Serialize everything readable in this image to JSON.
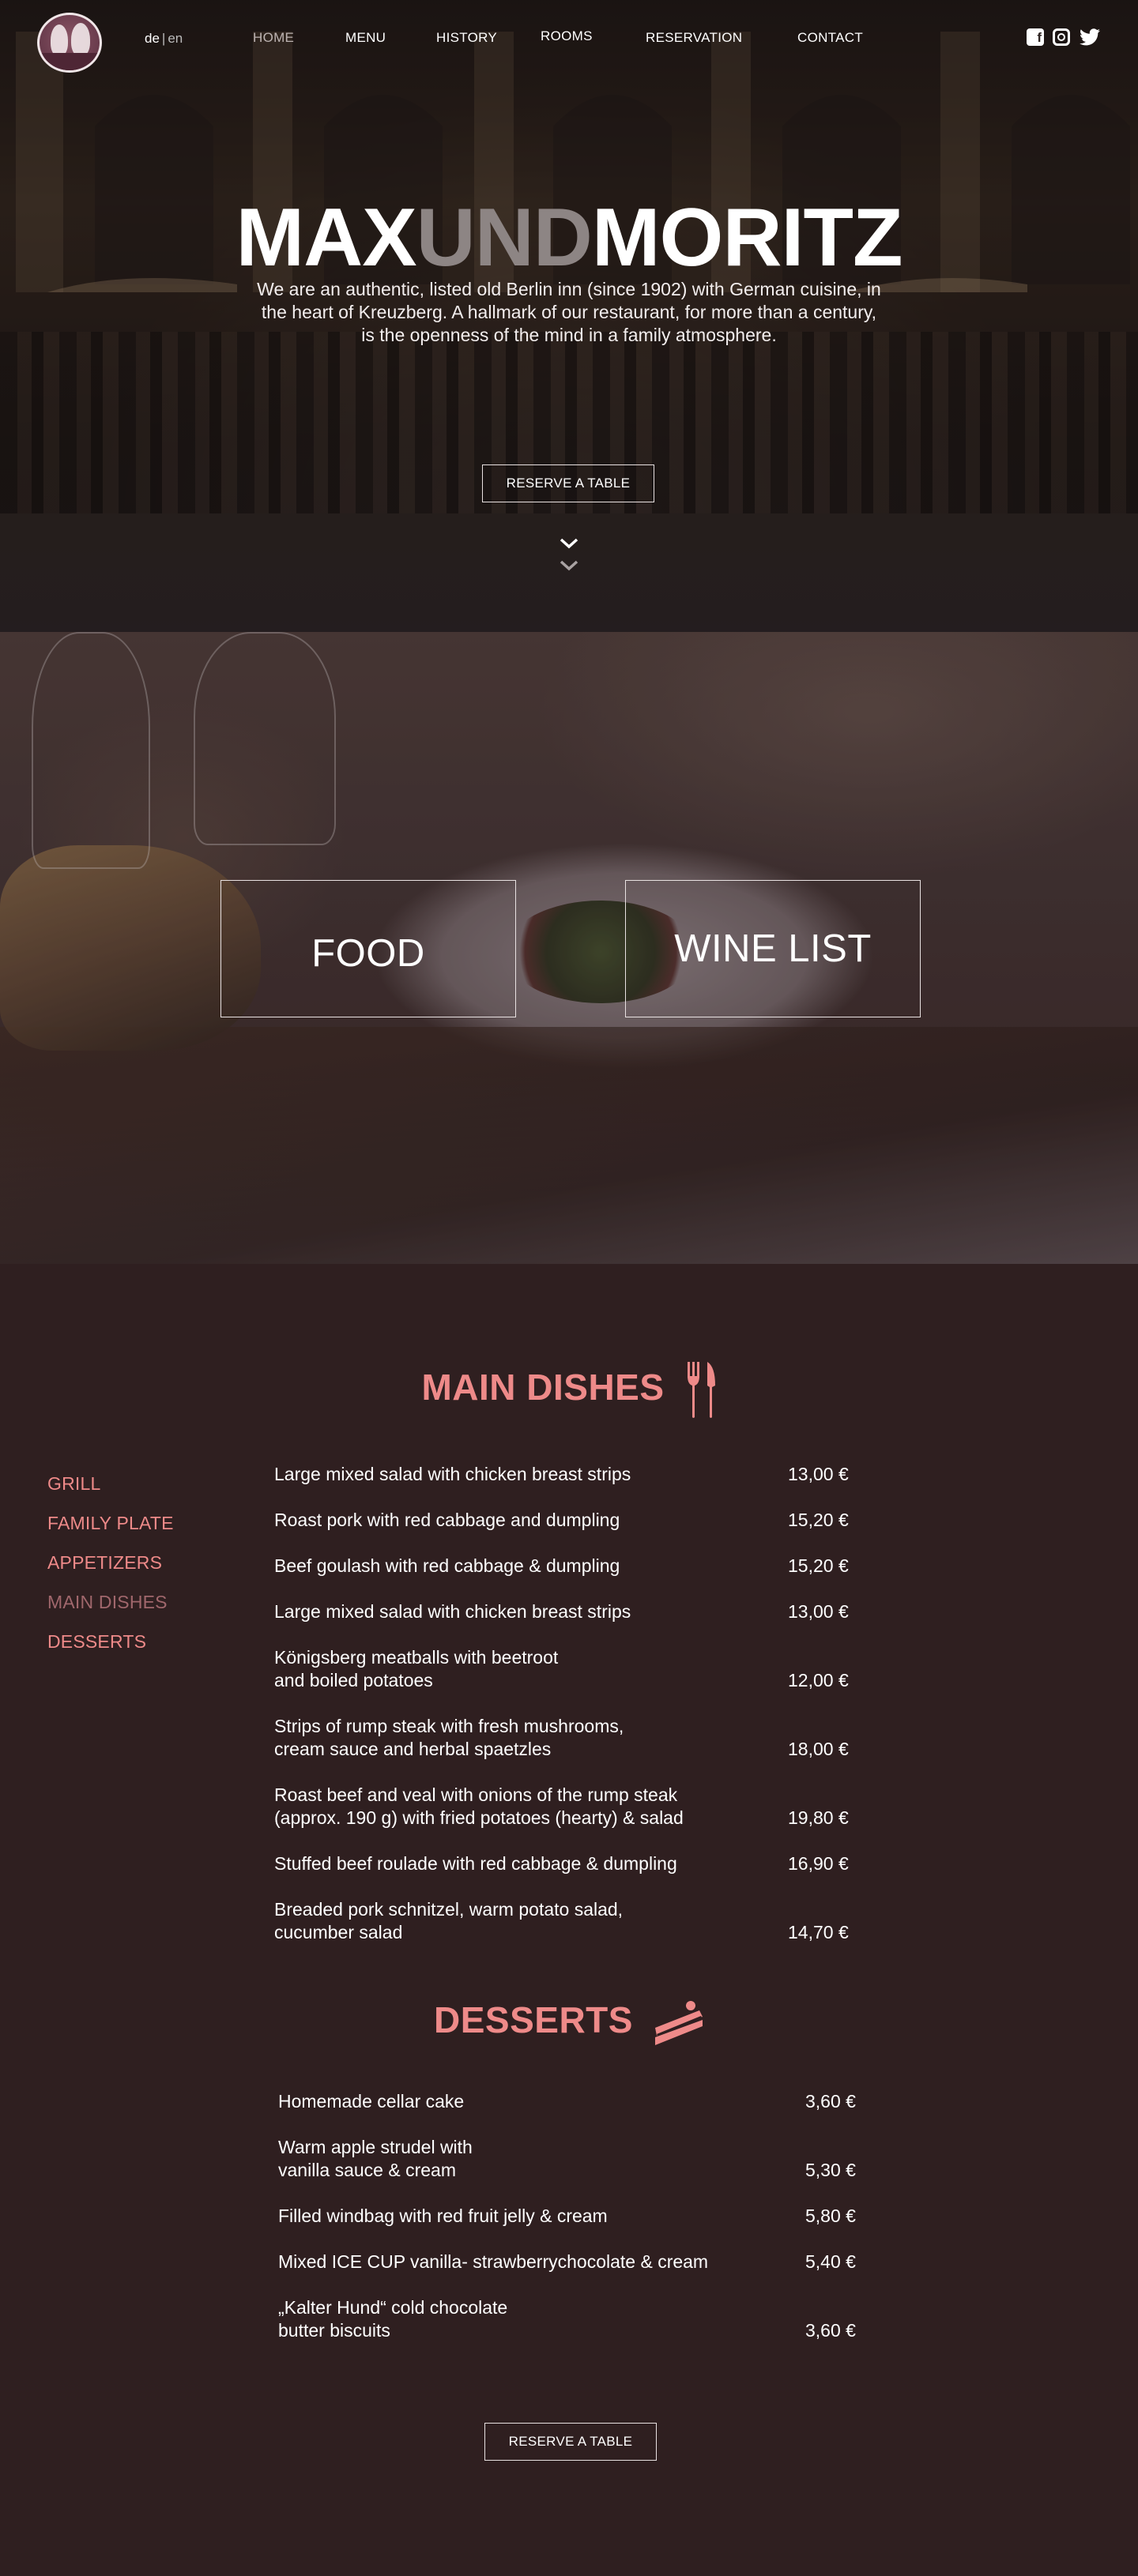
{
  "header": {
    "lang_current": "de",
    "lang_sep": "|",
    "lang_other": "en",
    "nav": [
      "HOME",
      "MENU",
      "HISTORY",
      "ROOMS",
      "RESERVATION",
      "CONTACT"
    ]
  },
  "hero": {
    "title_part1": "MAX",
    "title_part2": "UND",
    "title_part3": "MORITZ",
    "description": "We are an authentic, listed old Berlin inn (since 1902) with German cuisine, in the heart of Kreuzberg. A hallmark of our restaurant, for more than a century, is the openness of the mind in a family atmosphere.",
    "reserve_label": "RESERVE A TABLE"
  },
  "categories": {
    "food": "FOOD",
    "wine": "WINE LIST"
  },
  "main_dishes": {
    "title": "MAIN DISHES",
    "sidebar": [
      "GRILL",
      "FAMILY PLATE",
      "APPETIZERS",
      "MAIN DISHES",
      "DESSERTS"
    ],
    "items": [
      {
        "line1": "Large mixed salad with chicken breast strips",
        "line2": "",
        "price": "13,00 €"
      },
      {
        "line1": "Roast pork with red cabbage and dumpling",
        "line2": "",
        "price": "15,20 €"
      },
      {
        "line1": "Beef goulash with red cabbage & dumpling",
        "line2": "",
        "price": "15,20 €"
      },
      {
        "line1": "Large mixed salad with chicken breast strips",
        "line2": "",
        "price": "13,00 €"
      },
      {
        "line1": "Königsberg meatballs with beetroot",
        "line2": "and boiled potatoes",
        "price": "12,00 €"
      },
      {
        "line1": "Strips of rump steak with fresh mushrooms,",
        "line2": "cream sauce and herbal spaetzles",
        "price": "18,00 €"
      },
      {
        "line1": "Roast beef and veal with onions of the rump steak",
        "line2": "(approx. 190 g) with fried potatoes (hearty) & salad",
        "price": "19,80 €"
      },
      {
        "line1": "Stuffed beef roulade with red cabbage & dumpling",
        "line2": "",
        "price": "16,90 €"
      },
      {
        "line1": "Breaded pork schnitzel, warm potato salad,",
        "line2": "cucumber salad",
        "price": "14,70 €"
      }
    ]
  },
  "desserts": {
    "title": "DESSERTS",
    "items": [
      {
        "line1": "Homemade cellar cake",
        "line2": "",
        "price": "3,60 €"
      },
      {
        "line1": "Warm apple strudel with",
        "line2": "vanilla sauce & cream",
        "price": "5,30 €"
      },
      {
        "line1": "Filled windbag with red fruit jelly & cream",
        "line2": "",
        "price": "5,80 €"
      },
      {
        "line1": "Mixed ICE CUP vanilla- strawberrychocolate & cream",
        "line2": "",
        "price": "5,40 €"
      },
      {
        "line1": "„Kalter Hund“ cold chocolate",
        "line2": "butter biscuits",
        "price": "3,60 €"
      }
    ],
    "reserve_label": "RESERVE A TABLE"
  },
  "colors": {
    "accent": "#ee8a89",
    "sidebar_active": "#a0676c",
    "background": "#2f1f20"
  },
  "icons": [
    "facebook-icon",
    "instagram-icon",
    "twitter-icon",
    "chevron-down-icon",
    "fork-knife-icon",
    "cake-slice-icon"
  ]
}
